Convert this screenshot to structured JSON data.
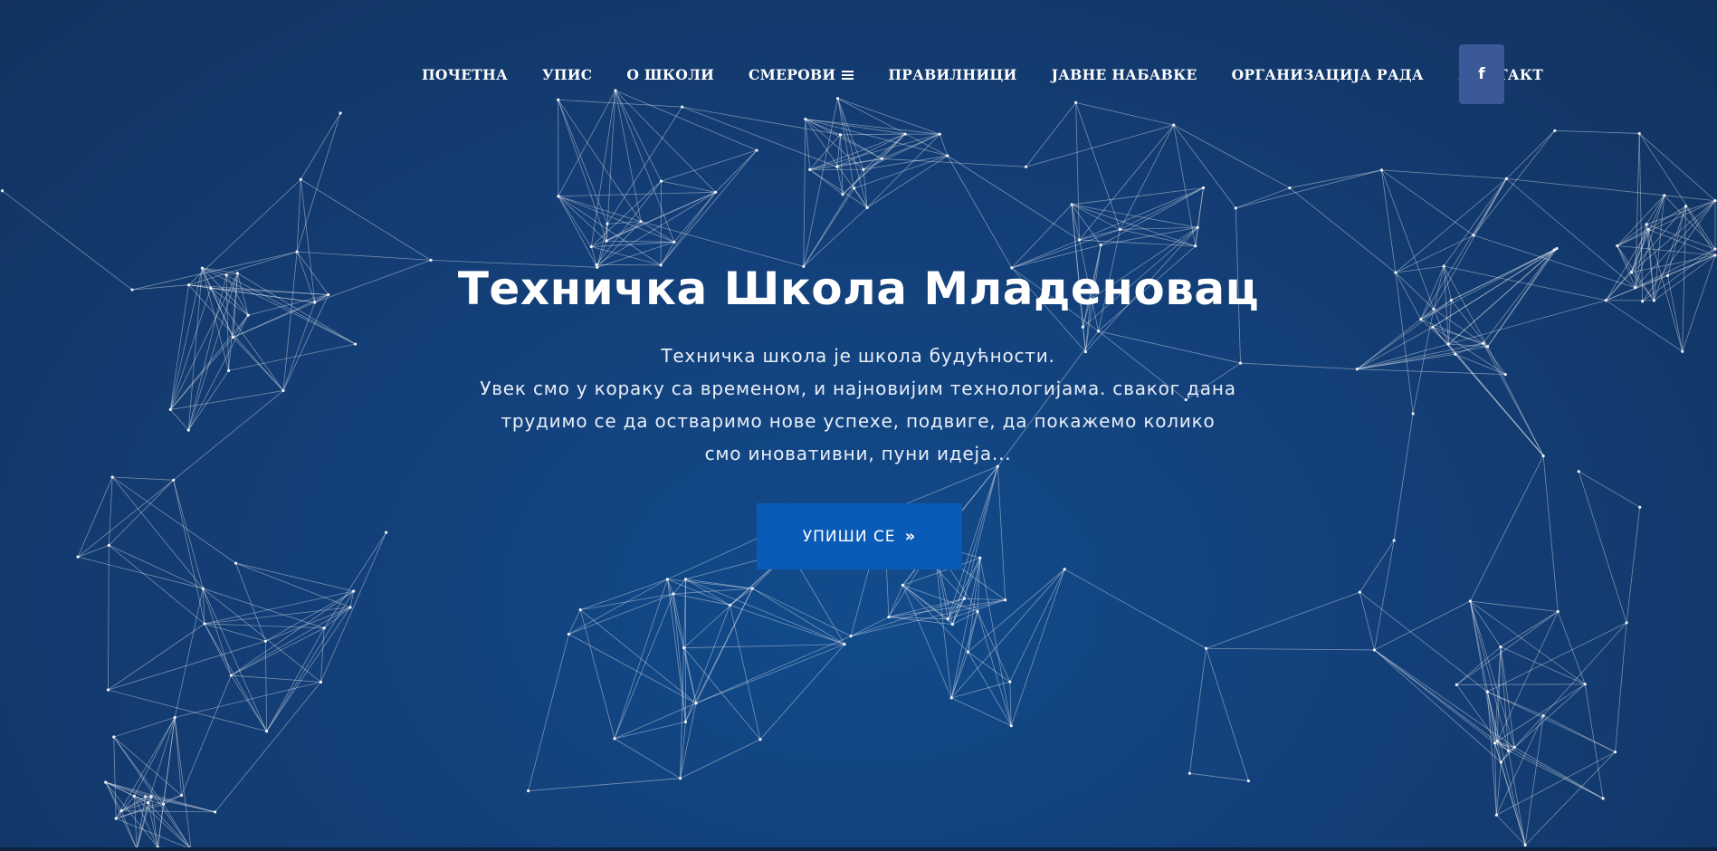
{
  "nav": {
    "items": [
      {
        "label": "ПОЧЕТНА"
      },
      {
        "label": "УПИС"
      },
      {
        "label": "О ШКОЛИ"
      },
      {
        "label": "СМЕРОВИ",
        "has_menu_icon": true
      },
      {
        "label": "ПРАВИЛНИЦИ"
      },
      {
        "label": "ЈАВНЕ НАБАВКЕ"
      },
      {
        "label": "ОРГАНИЗАЦИЈА РАДА"
      },
      {
        "label": "КОНТАКТ"
      }
    ],
    "social": {
      "icon": "facebook-icon",
      "glyph": "f",
      "color": "#3b5998"
    }
  },
  "hero": {
    "title": "Техничка Школа Младеновац",
    "lines": [
      "Техничка школа је школа будућности.",
      "Увек смо у кораку са временом, и најновијим технологијама. сваког дана",
      "трудимо се да остваримо нове успехе, подвиге, да покажемо колико",
      "смо иновативни, пуни идеја..."
    ],
    "cta": {
      "label": "УПИШИ СЕ",
      "arrow": "»"
    }
  },
  "colors": {
    "background": "#133f78",
    "cta": "#0a5bb8",
    "facebook": "#3b5998"
  }
}
